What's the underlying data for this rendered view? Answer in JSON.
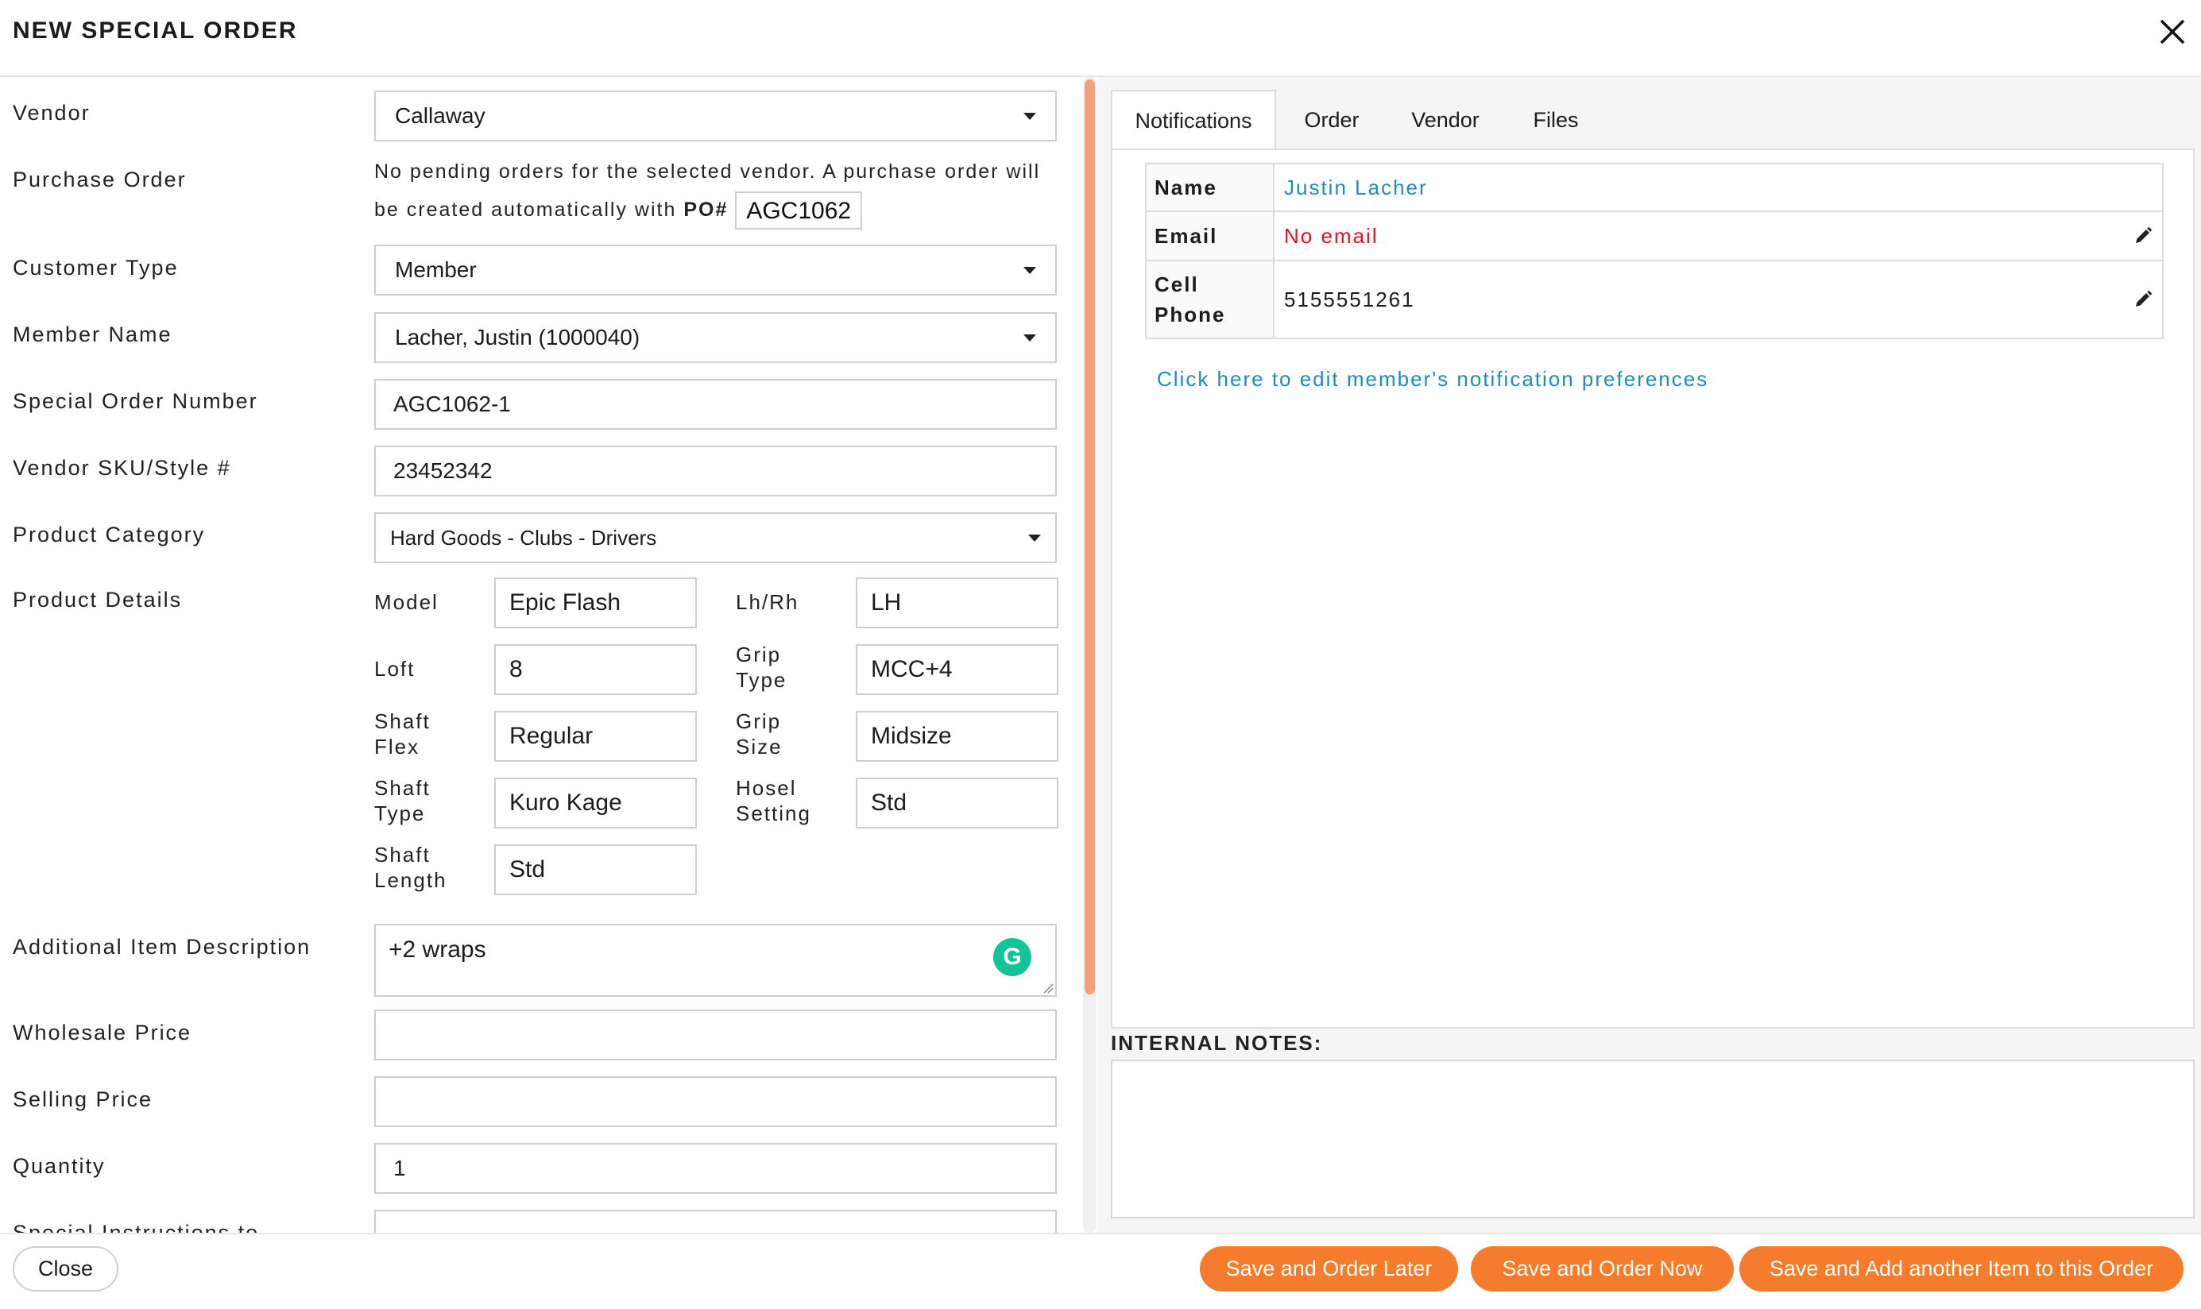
{
  "header": {
    "title": "NEW SPECIAL ORDER"
  },
  "form": {
    "vendor_label": "Vendor",
    "vendor_value": "Callaway",
    "po_label": "Purchase Order",
    "po_text": "No pending orders for the selected vendor. A purchase order will be created automatically with",
    "po_prefix": "PO#",
    "po_number": "AGC1062",
    "customer_type_label": "Customer Type",
    "customer_type_value": "Member",
    "member_name_label": "Member Name",
    "member_name_value": "Lacher, Justin (1000040)",
    "special_order_number_label": "Special Order Number",
    "special_order_number_value": "AGC1062-1",
    "vendor_sku_label": "Vendor SKU/Style #",
    "vendor_sku_value": "23452342",
    "product_category_label": "Product Category",
    "product_category_value": "Hard Goods - Clubs - Drivers",
    "product_details_label": "Product Details",
    "details": {
      "model_label": "Model",
      "model_value": "Epic Flash",
      "lhrh_label": "Lh/Rh",
      "lhrh_value": "LH",
      "loft_label": "Loft",
      "loft_value": "8",
      "grip_type_label": "Grip Type",
      "grip_type_value": "MCC+4",
      "shaft_flex_label": "Shaft Flex",
      "shaft_flex_value": "Regular",
      "grip_size_label": "Grip Size",
      "grip_size_value": "Midsize",
      "shaft_type_label": "Shaft Type",
      "shaft_type_value": "Kuro Kage",
      "hosel_setting_label": "Hosel Setting",
      "hosel_setting_value": "Std",
      "shaft_length_label": "Shaft Length",
      "shaft_length_value": "Std"
    },
    "additional_desc_label": "Additional Item Description",
    "additional_desc_value": "+2 wraps",
    "grammarly_glyph": "G",
    "wholesale_label": "Wholesale Price",
    "wholesale_value": "",
    "selling_label": "Selling Price",
    "selling_value": "",
    "quantity_label": "Quantity",
    "quantity_value": "1",
    "special_instructions_label": "Special Instructions to"
  },
  "tabs": [
    {
      "label": "Notifications",
      "active": true
    },
    {
      "label": "Order",
      "active": false
    },
    {
      "label": "Vendor",
      "active": false
    },
    {
      "label": "Files",
      "active": false
    }
  ],
  "notifications": {
    "name_label": "Name",
    "name_value": "Justin Lacher",
    "email_label": "Email",
    "email_value": "No email",
    "cell_label_1": "Cell",
    "cell_label_2": "Phone",
    "cell_value": "5155551261",
    "pref_link": "Click here to edit member's notification preferences"
  },
  "internal_notes": {
    "label": "INTERNAL NOTES:"
  },
  "footer": {
    "close": "Close",
    "save_later": "Save and Order Later",
    "save_now": "Save and Order Now",
    "save_add": "Save and Add another Item to this Order"
  },
  "colors": {
    "accent": "#f57c2c",
    "link": "#1e8cbf",
    "error": "#e8101b",
    "scroll_thumb": "#f2a07a"
  },
  "icons": {
    "close": "close-icon",
    "caret": "chevron-down-icon",
    "edit": "pencil-icon"
  }
}
